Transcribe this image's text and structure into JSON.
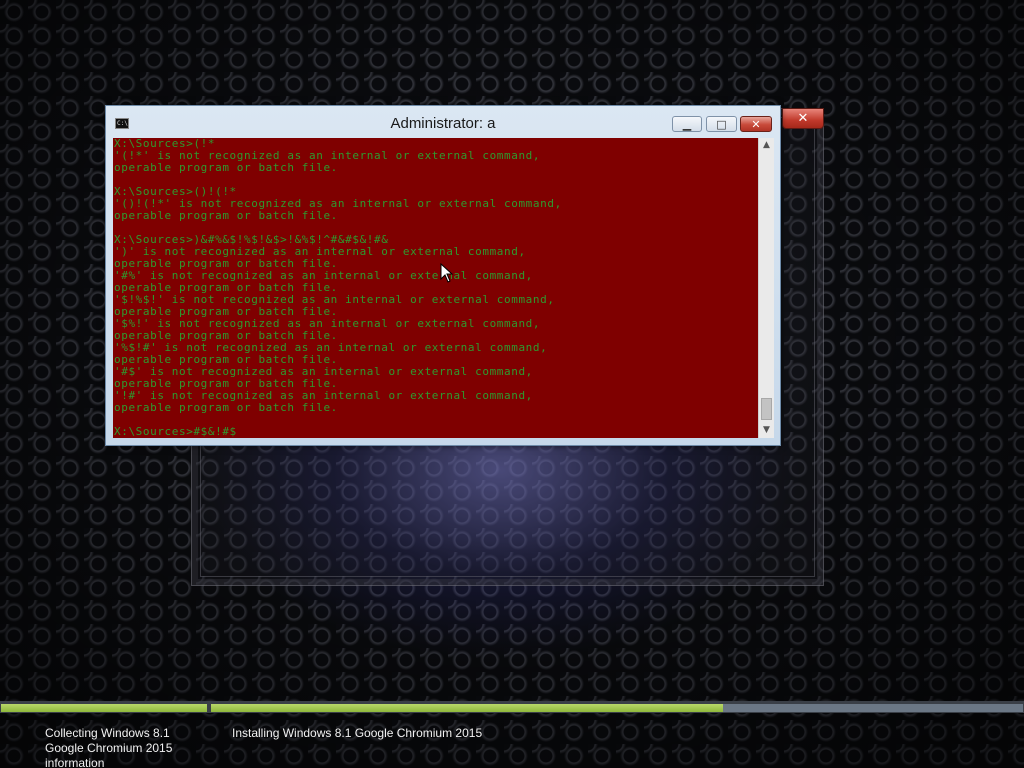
{
  "console_window": {
    "title": "Administrator:  a",
    "icon": "cmd-icon",
    "icon_text": "C:\\",
    "controls": {
      "minimize": "minimize-icon",
      "maximize": "maximize-icon",
      "close": "close-icon"
    },
    "background_color": "#7f0000",
    "text_color": "#2e9a2e",
    "lines": [
      "X:\\Sources>(!*",
      "'(!*' is not recognized as an internal or external command,",
      "operable program or batch file.",
      "",
      "X:\\Sources>()!(!*",
      "'()!(!*' is not recognized as an internal or external command,",
      "operable program or batch file.",
      "",
      "X:\\Sources>)&#%&$!%$!&$>!&%$!^#&#$&!#&",
      "')' is not recognized as an internal or external command,",
      "operable program or batch file.",
      "'#%' is not recognized as an internal or external command,",
      "operable program or batch file.",
      "'$!%$!' is not recognized as an internal or external command,",
      "operable program or batch file.",
      "'$%!' is not recognized as an internal or external command,",
      "operable program or batch file.",
      "'%$!#' is not recognized as an internal or external command,",
      "operable program or batch file.",
      "'#$' is not recognized as an internal or external command,",
      "operable program or batch file.",
      "'!#' is not recognized as an internal or external command,",
      "operable program or batch file.",
      "",
      "X:\\Sources>#$&!#$"
    ]
  },
  "background_window": {
    "close_icon": "close-icon"
  },
  "setup_progress": {
    "steps": [
      {
        "label": "Collecting Windows 8.1 Google Chromium 2015 information",
        "progress": 1.0
      },
      {
        "label": "Installing Windows 8.1 Google Chromium 2015",
        "progress": 0.63
      }
    ],
    "fill_color": "#9dc24a"
  }
}
